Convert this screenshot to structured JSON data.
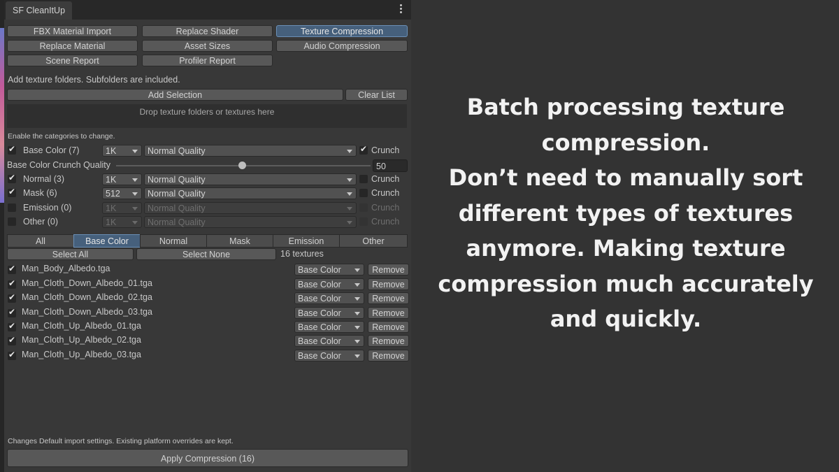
{
  "window": {
    "tab_title": "SF CleanItUp"
  },
  "tools": {
    "row1": [
      "FBX Material Import",
      "Replace Shader",
      "Texture Compression"
    ],
    "row2": [
      "Replace Material",
      "Asset Sizes",
      "Audio Compression"
    ],
    "row3": [
      "Scene Report",
      "Profiler Report"
    ],
    "active": "Texture Compression"
  },
  "folders": {
    "hint": "Add texture folders. Subfolders are included.",
    "add_selection": "Add Selection",
    "clear_list": "Clear List",
    "drop_hint": "Drop texture folders or textures here"
  },
  "categories": {
    "hint": "Enable the categories to change.",
    "crunch_label": "Crunch",
    "rows": [
      {
        "label": "Base Color (7)",
        "enabled": true,
        "size": "1K",
        "quality": "Normal Quality",
        "crunch": true
      },
      {
        "label": "Normal (3)",
        "enabled": true,
        "size": "1K",
        "quality": "Normal Quality",
        "crunch": false
      },
      {
        "label": "Mask (6)",
        "enabled": true,
        "size": "512",
        "quality": "Normal Quality",
        "crunch": false
      },
      {
        "label": "Emission (0)",
        "enabled": false,
        "size": "1K",
        "quality": "Normal Quality",
        "crunch": false
      },
      {
        "label": "Other (0)",
        "enabled": false,
        "size": "1K",
        "quality": "Normal Quality",
        "crunch": false
      }
    ],
    "crunch_quality": {
      "label": "Base Color Crunch Quality",
      "value": "50",
      "slider_fraction": 0.5
    }
  },
  "filters": {
    "tabs": [
      "All",
      "Base Color",
      "Normal",
      "Mask",
      "Emission",
      "Other"
    ],
    "active": "Base Color",
    "select_all": "Select All",
    "select_none": "Select None",
    "count": "16 textures"
  },
  "textures": {
    "remove_label": "Remove",
    "items": [
      {
        "name": "Man_Body_Albedo.tga",
        "type": "Base Color",
        "checked": true
      },
      {
        "name": "Man_Cloth_Down_Albedo_01.tga",
        "type": "Base Color",
        "checked": true
      },
      {
        "name": "Man_Cloth_Down_Albedo_02.tga",
        "type": "Base Color",
        "checked": true
      },
      {
        "name": "Man_Cloth_Down_Albedo_03.tga",
        "type": "Base Color",
        "checked": true
      },
      {
        "name": "Man_Cloth_Up_Albedo_01.tga",
        "type": "Base Color",
        "checked": true
      },
      {
        "name": "Man_Cloth_Up_Albedo_02.tga",
        "type": "Base Color",
        "checked": true
      },
      {
        "name": "Man_Cloth_Up_Albedo_03.tga",
        "type": "Base Color",
        "checked": true
      }
    ]
  },
  "footer": {
    "note": "Changes Default import settings. Existing platform overrides are kept.",
    "apply": "Apply Compression (16)"
  },
  "caption": {
    "lines": [
      "Batch processing texture",
      "compression.",
      "Don’t need to manually sort",
      "different types of textures",
      "anymore. Making texture",
      "compression much accurately",
      "and quickly."
    ]
  },
  "colors": {
    "accent": "#46607c",
    "panel": "#383838",
    "background": "#333333"
  }
}
